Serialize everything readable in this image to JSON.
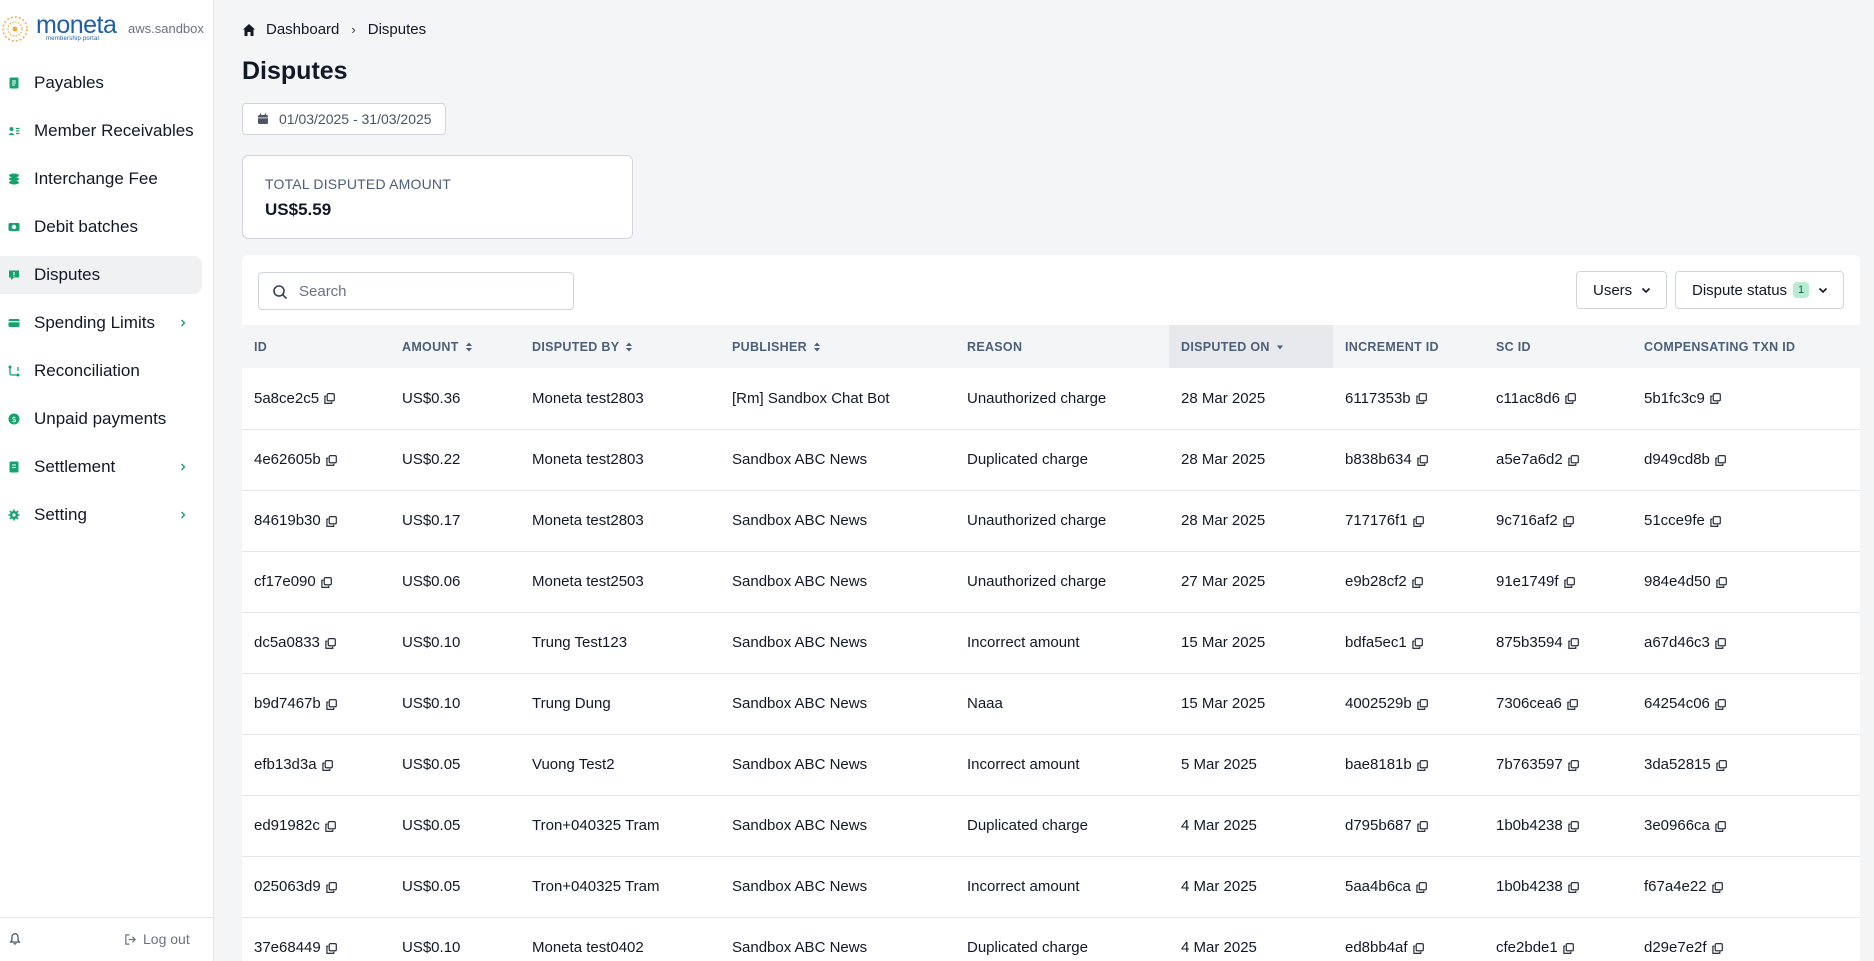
{
  "brand": {
    "name": "moneta",
    "tagline": "membership portal",
    "environment": "aws.sandbox",
    "color": "#1f5fa8"
  },
  "accent_color": "#14a36b",
  "sidebar": {
    "items": [
      {
        "label": "Payables",
        "icon": "payables-icon",
        "has_submenu": false,
        "active": false
      },
      {
        "label": "Member Receivables",
        "icon": "member-receivables-icon",
        "has_submenu": false,
        "active": false
      },
      {
        "label": "Interchange Fee",
        "icon": "interchange-fee-icon",
        "has_submenu": false,
        "active": false
      },
      {
        "label": "Debit batches",
        "icon": "debit-batches-icon",
        "has_submenu": false,
        "active": false
      },
      {
        "label": "Disputes",
        "icon": "disputes-icon",
        "has_submenu": false,
        "active": true
      },
      {
        "label": "Spending Limits",
        "icon": "spending-limits-icon",
        "has_submenu": true,
        "active": false
      },
      {
        "label": "Reconciliation",
        "icon": "reconciliation-icon",
        "has_submenu": false,
        "active": false
      },
      {
        "label": "Unpaid payments",
        "icon": "unpaid-payments-icon",
        "has_submenu": false,
        "active": false
      },
      {
        "label": "Settlement",
        "icon": "settlement-icon",
        "has_submenu": true,
        "active": false
      },
      {
        "label": "Setting",
        "icon": "gear-icon",
        "has_submenu": true,
        "active": false
      }
    ],
    "logout_label": "Log out"
  },
  "breadcrumb": {
    "home": "Dashboard",
    "current": "Disputes"
  },
  "page": {
    "title": "Disputes",
    "date_range": "01/03/2025 - 31/03/2025"
  },
  "summary": {
    "label": "TOTAL DISPUTED AMOUNT",
    "value": "US$5.59"
  },
  "toolbar": {
    "search_placeholder": "Search",
    "users_label": "Users",
    "status_label": "Dispute status",
    "status_count": "1"
  },
  "table": {
    "columns": [
      {
        "label": "ID",
        "sort": "none"
      },
      {
        "label": "AMOUNT",
        "sort": "both"
      },
      {
        "label": "DISPUTED BY",
        "sort": "both"
      },
      {
        "label": "PUBLISHER",
        "sort": "both"
      },
      {
        "label": "REASON",
        "sort": "none"
      },
      {
        "label": "DISPUTED ON",
        "sort": "desc"
      },
      {
        "label": "INCREMENT ID",
        "sort": "none"
      },
      {
        "label": "SC ID",
        "sort": "none"
      },
      {
        "label": "COMPENSATING TXN ID",
        "sort": "none"
      }
    ],
    "rows": [
      [
        "5a8ce2c5",
        "US$0.36",
        "Moneta test2803",
        "[Rm] Sandbox Chat Bot",
        "Unauthorized charge",
        "28 Mar 2025",
        "6117353b",
        "c11ac8d6",
        "5b1fc3c9"
      ],
      [
        "4e62605b",
        "US$0.22",
        "Moneta test2803",
        "Sandbox ABC News",
        "Duplicated charge",
        "28 Mar 2025",
        "b838b634",
        "a5e7a6d2",
        "d949cd8b"
      ],
      [
        "84619b30",
        "US$0.17",
        "Moneta test2803",
        "Sandbox ABC News",
        "Unauthorized charge",
        "28 Mar 2025",
        "717176f1",
        "9c716af2",
        "51cce9fe"
      ],
      [
        "cf17e090",
        "US$0.06",
        "Moneta test2503",
        "Sandbox ABC News",
        "Unauthorized charge",
        "27 Mar 2025",
        "e9b28cf2",
        "91e1749f",
        "984e4d50"
      ],
      [
        "dc5a0833",
        "US$0.10",
        "Trung Test123",
        "Sandbox ABC News",
        "Incorrect amount",
        "15 Mar 2025",
        "bdfa5ec1",
        "875b3594",
        "a67d46c3"
      ],
      [
        "b9d7467b",
        "US$0.10",
        "Trung Dung",
        "Sandbox ABC News",
        "Naaa",
        "15 Mar 2025",
        "4002529b",
        "7306cea6",
        "64254c06"
      ],
      [
        "efb13d3a",
        "US$0.05",
        "Vuong Test2",
        "Sandbox ABC News",
        "Incorrect amount",
        "5 Mar 2025",
        "bae8181b",
        "7b763597",
        "3da52815"
      ],
      [
        "ed91982c",
        "US$0.05",
        "Tron+040325 Tram",
        "Sandbox ABC News",
        "Duplicated charge",
        "4 Mar 2025",
        "d795b687",
        "1b0b4238",
        "3e0966ca"
      ],
      [
        "025063d9",
        "US$0.05",
        "Tron+040325 Tram",
        "Sandbox ABC News",
        "Incorrect amount",
        "4 Mar 2025",
        "5aa4b6ca",
        "1b0b4238",
        "f67a4e22"
      ],
      [
        "37e68449",
        "US$0.10",
        "Moneta test0402",
        "Sandbox ABC News",
        "Duplicated charge",
        "4 Mar 2025",
        "ed8bb4af",
        "cfe2bde1",
        "d29e7e2f"
      ]
    ]
  }
}
